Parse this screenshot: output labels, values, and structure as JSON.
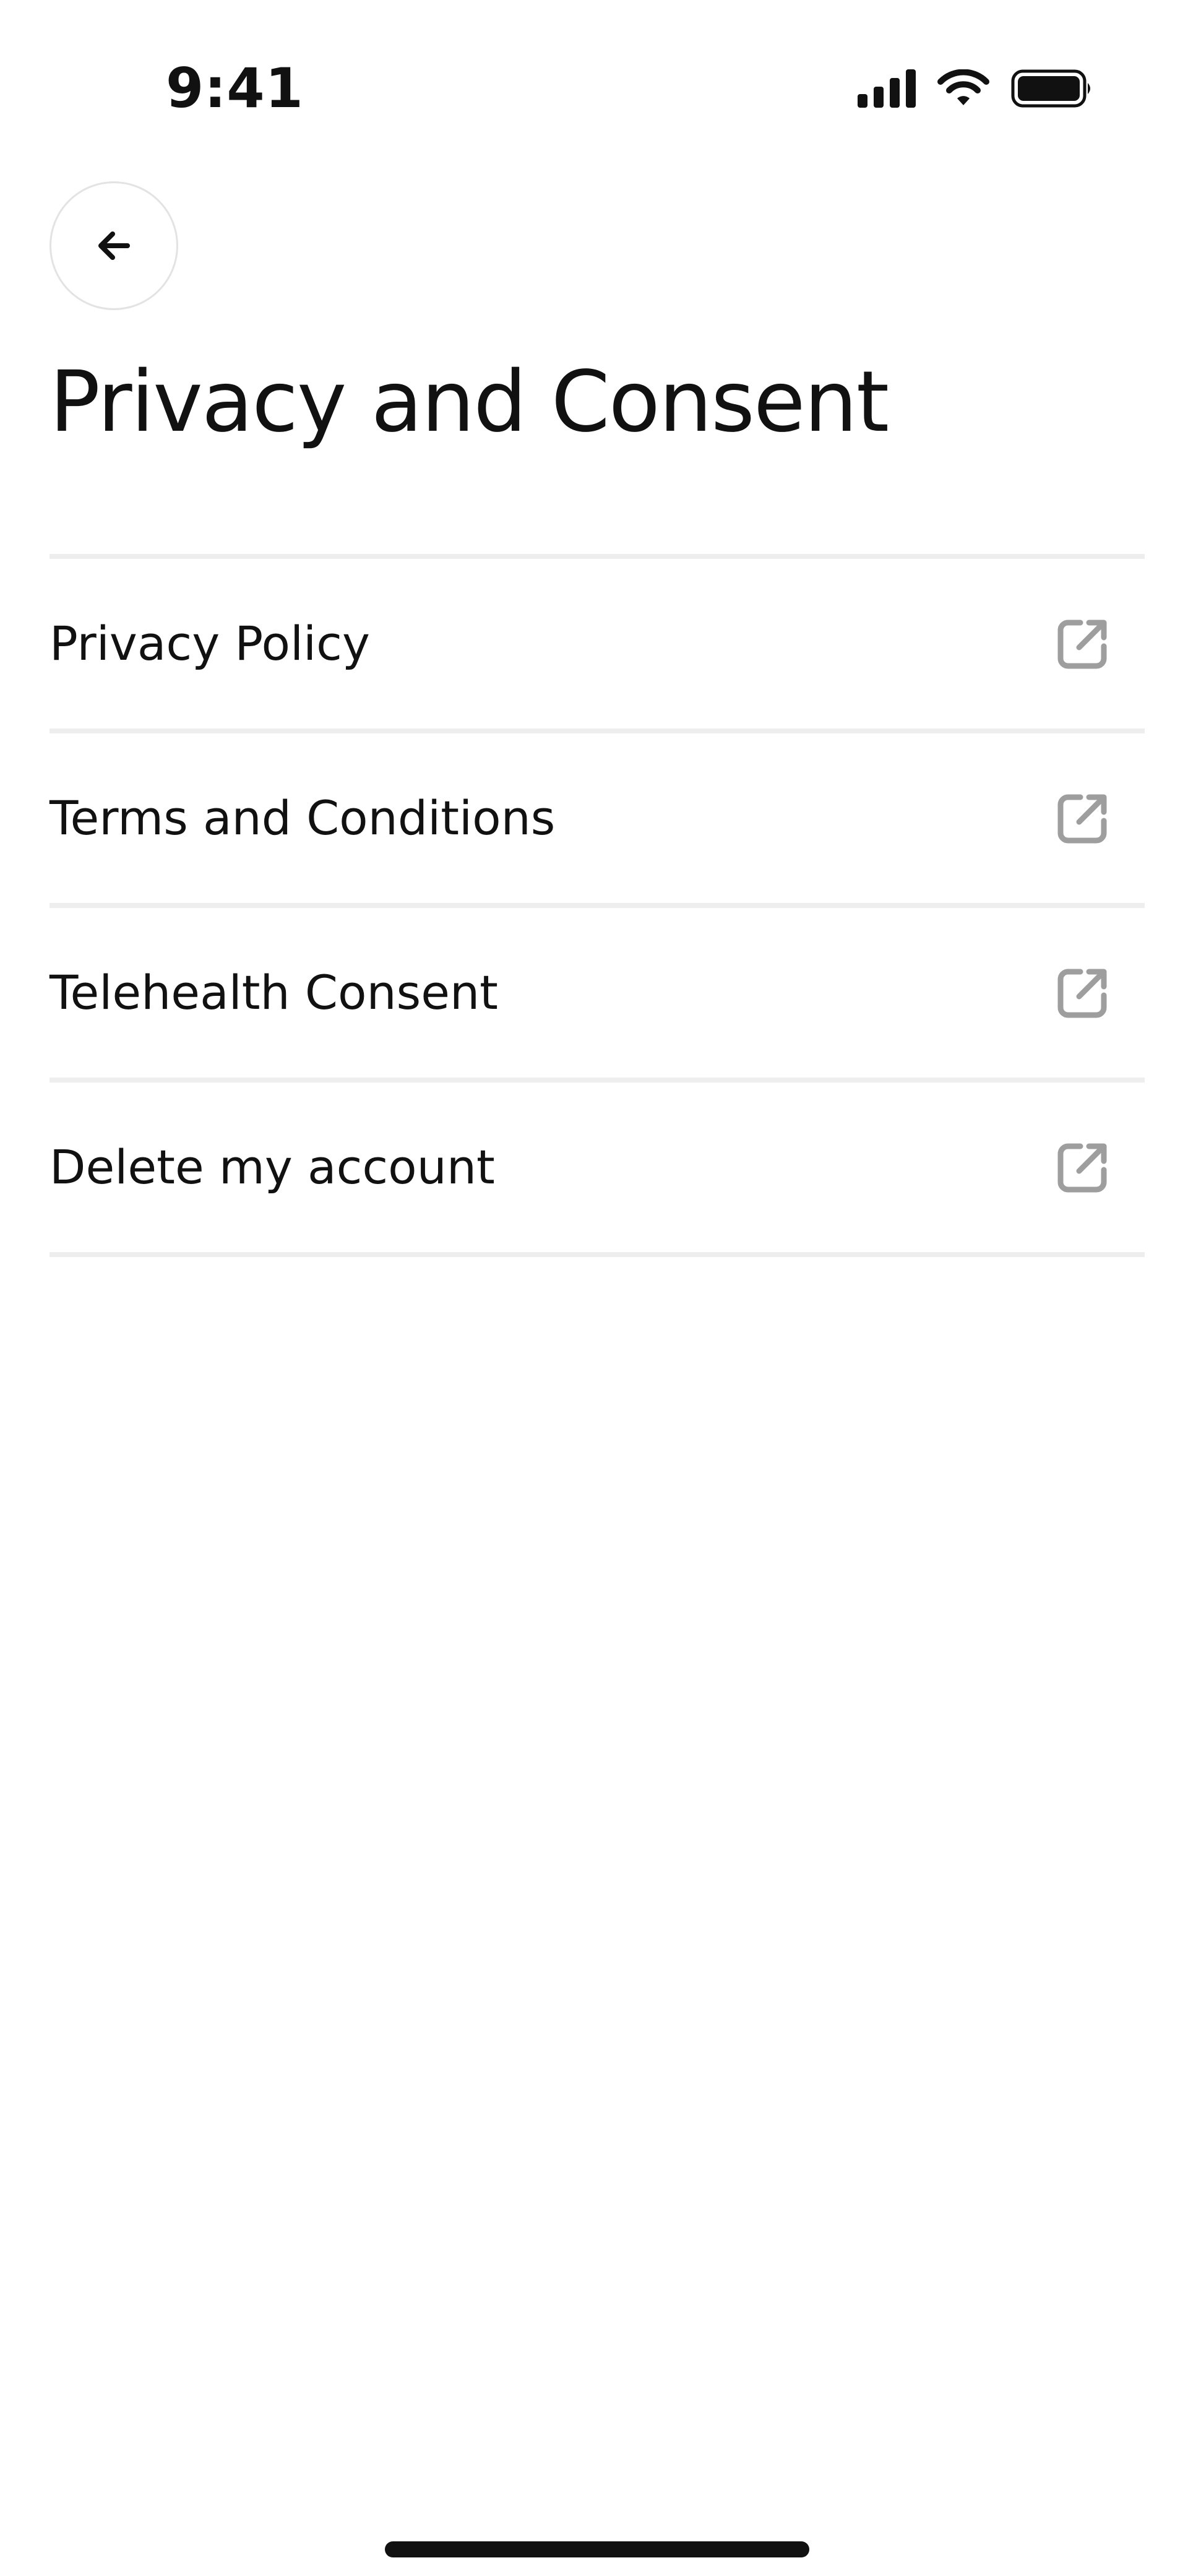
{
  "status_bar": {
    "time": "9:41",
    "icons": [
      "signal-icon",
      "wifi-icon",
      "battery-icon"
    ]
  },
  "header": {
    "back_icon": "arrow-left-icon",
    "title": "Privacy and Consent"
  },
  "menu": {
    "items": [
      {
        "label": "Privacy Policy",
        "icon": "external-link-icon"
      },
      {
        "label": "Terms and Conditions",
        "icon": "external-link-icon"
      },
      {
        "label": "Telehealth Consent",
        "icon": "external-link-icon"
      },
      {
        "label": "Delete my account",
        "icon": "external-link-icon"
      }
    ]
  },
  "colors": {
    "text": "#111111",
    "divider": "#eeeeee",
    "icon": "#9e9e9e",
    "background": "#ffffff"
  }
}
